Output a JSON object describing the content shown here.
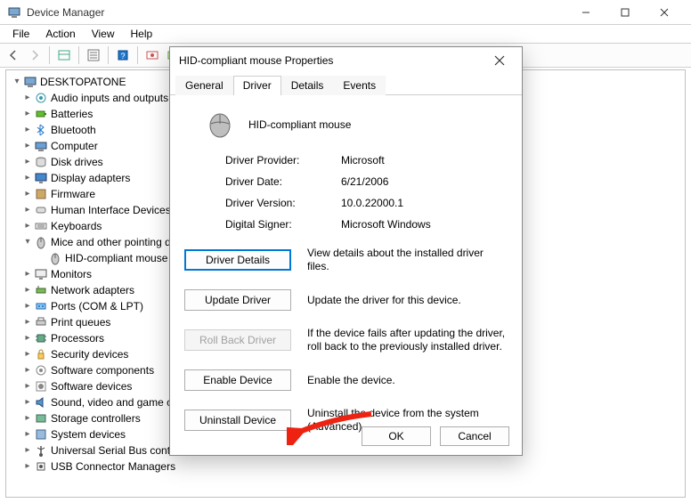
{
  "window": {
    "title": "Device Manager",
    "menus": [
      "File",
      "Action",
      "View",
      "Help"
    ]
  },
  "tree": {
    "root": "DESKTOPATONE",
    "nodes": [
      {
        "label": "Audio inputs and outputs",
        "icon": "audio"
      },
      {
        "label": "Batteries",
        "icon": "battery"
      },
      {
        "label": "Bluetooth",
        "icon": "bluetooth"
      },
      {
        "label": "Computer",
        "icon": "computer"
      },
      {
        "label": "Disk drives",
        "icon": "disk"
      },
      {
        "label": "Display adapters",
        "icon": "display"
      },
      {
        "label": "Firmware",
        "icon": "firmware"
      },
      {
        "label": "Human Interface Devices",
        "icon": "hid"
      },
      {
        "label": "Keyboards",
        "icon": "keyboard"
      },
      {
        "label": "Mice and other pointing devices",
        "icon": "mouse",
        "expanded": true,
        "children": [
          {
            "label": "HID-compliant mouse",
            "icon": "mouse"
          }
        ]
      },
      {
        "label": "Monitors",
        "icon": "monitor"
      },
      {
        "label": "Network adapters",
        "icon": "network"
      },
      {
        "label": "Ports (COM & LPT)",
        "icon": "ports"
      },
      {
        "label": "Print queues",
        "icon": "print"
      },
      {
        "label": "Processors",
        "icon": "cpu"
      },
      {
        "label": "Security devices",
        "icon": "security"
      },
      {
        "label": "Software components",
        "icon": "swcomp"
      },
      {
        "label": "Software devices",
        "icon": "swdev"
      },
      {
        "label": "Sound, video and game controllers",
        "icon": "sound"
      },
      {
        "label": "Storage controllers",
        "icon": "storage"
      },
      {
        "label": "System devices",
        "icon": "system"
      },
      {
        "label": "Universal Serial Bus controllers",
        "icon": "usb"
      },
      {
        "label": "USB Connector Managers",
        "icon": "usbcm"
      }
    ]
  },
  "dialog": {
    "title": "HID-compliant mouse Properties",
    "tabs": [
      "General",
      "Driver",
      "Details",
      "Events"
    ],
    "active_tab": "Driver",
    "device_name": "HID-compliant mouse",
    "fields": {
      "provider_label": "Driver Provider:",
      "provider_value": "Microsoft",
      "date_label": "Driver Date:",
      "date_value": "6/21/2006",
      "version_label": "Driver Version:",
      "version_value": "10.0.22000.1",
      "signer_label": "Digital Signer:",
      "signer_value": "Microsoft Windows"
    },
    "buttons": {
      "details": "Driver Details",
      "details_desc": "View details about the installed driver files.",
      "update": "Update Driver",
      "update_desc": "Update the driver for this device.",
      "rollback": "Roll Back Driver",
      "rollback_desc": "If the device fails after updating the driver, roll back to the previously installed driver.",
      "enable": "Enable Device",
      "enable_desc": "Enable the device.",
      "uninstall": "Uninstall Device",
      "uninstall_desc": "Uninstall the device from the system (Advanced)."
    },
    "ok": "OK",
    "cancel": "Cancel"
  }
}
